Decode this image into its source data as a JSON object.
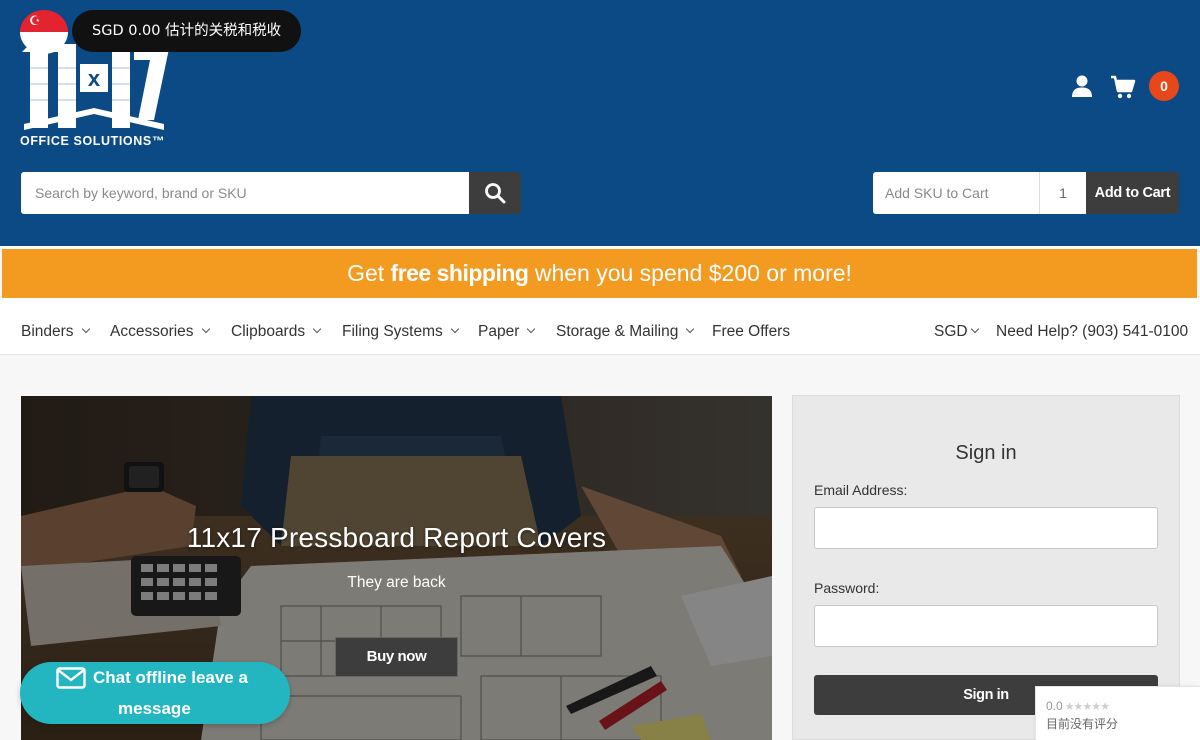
{
  "colors": {
    "header_bg": "#0c4a85",
    "promo_bg": "#f39a21",
    "button_dark": "#3d3d3d",
    "cart_badge": "#e8471a",
    "chat_bg": "#23b6c0"
  },
  "currency_popup": {
    "text": "SGD 0.00 估计的关税和税收",
    "flag_icon": "singapore-flag-icon"
  },
  "logo": {
    "mark": "11x17",
    "text": "OFFICE SOLUTIONS™"
  },
  "header": {
    "user_icon": "user-icon",
    "cart_icon": "cart-icon",
    "cart_count": "0",
    "search": {
      "placeholder": "Search by keyword, brand or SKU",
      "button_icon": "search-icon"
    },
    "quick_add": {
      "sku_placeholder": "Add SKU to Cart",
      "quantity": "1",
      "button_label": "Add to Cart"
    }
  },
  "promo": {
    "prefix": "Get ",
    "highlight": "free shipping",
    "suffix": " when you spend $200 or more!"
  },
  "nav": {
    "items": [
      {
        "label": "Binders",
        "dropdown": true
      },
      {
        "label": "Accessories",
        "dropdown": true
      },
      {
        "label": "Clipboards",
        "dropdown": true
      },
      {
        "label": "Filing Systems",
        "dropdown": true
      },
      {
        "label": "Paper",
        "dropdown": true
      },
      {
        "label": "Storage & Mailing",
        "dropdown": true
      },
      {
        "label": "Free Offers",
        "dropdown": false
      }
    ],
    "currency": "SGD",
    "help": "Need Help? (903) 541-0100"
  },
  "hero": {
    "title": "11x17 Pressboard Report Covers",
    "subtitle": "They are back",
    "button_label": "Buy now"
  },
  "signin": {
    "title": "Sign in",
    "email_label": "Email Address:",
    "password_label": "Password:",
    "button_label": "Sign in"
  },
  "chat": {
    "line1": "Chat offline leave a",
    "line2": "message",
    "icon": "envelope-icon"
  },
  "rating": {
    "score": "0.0",
    "stars": "★★★★★",
    "text": "目前没有评分"
  }
}
